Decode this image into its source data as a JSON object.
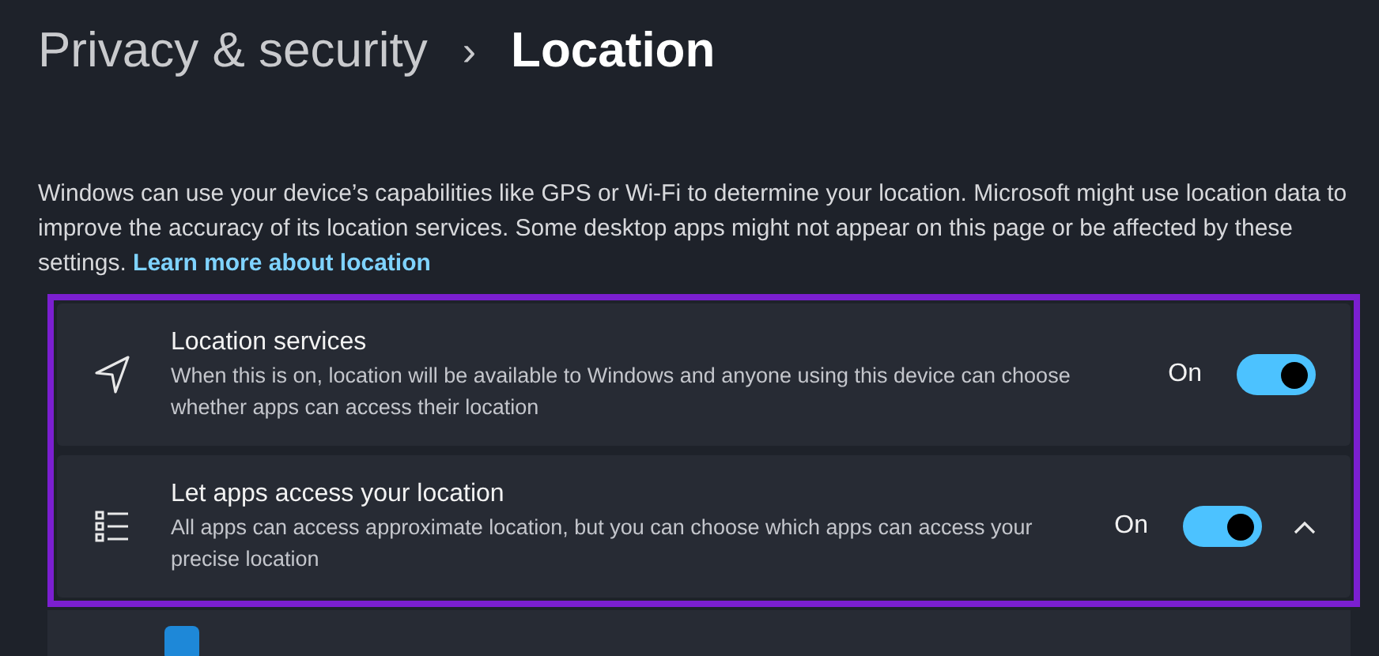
{
  "breadcrumb": {
    "parent": "Privacy & security",
    "separator": "›",
    "current": "Location"
  },
  "description": {
    "text": "Windows can use your device’s capabilities like GPS or Wi-Fi to determine your location. Microsoft might use location data to improve the accuracy of its location services. Some desktop apps might not appear on this page or be affected by these settings.",
    "link": "Learn more about location"
  },
  "highlight": {
    "on": true
  },
  "settings": [
    {
      "kind": "toggle",
      "title": "Location services",
      "subtitle": "When this is on, location will be available to Windows and anyone using this device can choose whether apps can access their location",
      "state_label": "On",
      "on": true
    },
    {
      "kind": "toggle",
      "title": "Let apps access your location",
      "subtitle": "All apps can access approximate location, but you can choose which apps can access your precise location",
      "state_label": "On",
      "on": true,
      "expanded": true
    }
  ],
  "sub_items": [
    {
      "checked": true
    }
  ]
}
